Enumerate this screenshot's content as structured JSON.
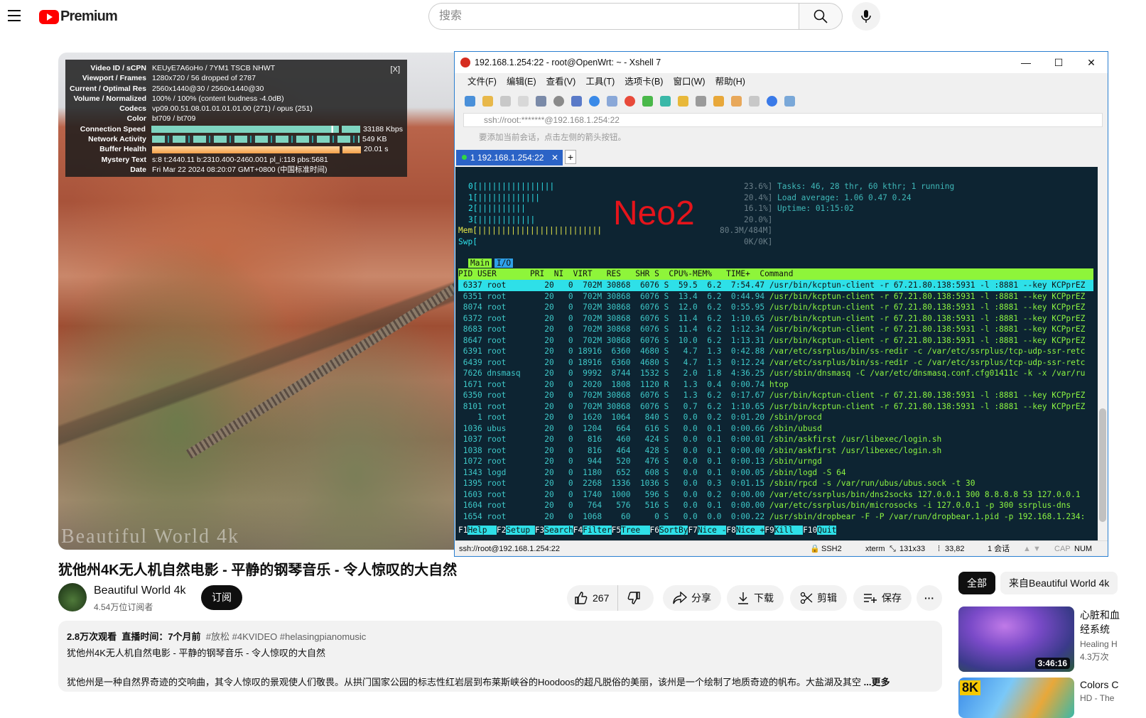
{
  "header": {
    "logo_text": "Premium",
    "search_placeholder": "搜索"
  },
  "stats": {
    "close": "[X]",
    "rows": [
      {
        "k": "Video ID / sCPN",
        "v": "KEUyE7A6oHo  /  7YM1  TSCB  NHWT"
      },
      {
        "k": "Viewport / Frames",
        "v": "1280x720 / 56 dropped of 2787"
      },
      {
        "k": "Current / Optimal Res",
        "v": "2560x1440@30 / 2560x1440@30"
      },
      {
        "k": "Volume / Normalized",
        "v": "100% / 100% (content loudness -4.0dB)"
      },
      {
        "k": "Codecs",
        "v": "vp09.00.51.08.01.01.01.01.00 (271) / opus (251)"
      },
      {
        "k": "Color",
        "v": "bt709 / bt709"
      },
      {
        "k": "Connection Speed",
        "v": "33188 Kbps"
      },
      {
        "k": "Network Activity",
        "v": "549 KB"
      },
      {
        "k": "Buffer Health",
        "v": "20.01 s"
      },
      {
        "k": "Mystery Text",
        "v": "s:8 t:2440.11 b:2310.400-2460.001 pl_i:118 pbs:5681"
      },
      {
        "k": "Date",
        "v": "Fri Mar 22 2024 08:20:07 GMT+0800 (中国标准时间)"
      }
    ]
  },
  "player": {
    "watermark": "Beautiful World 4k"
  },
  "xshell": {
    "title": "192.168.1.254:22 - root@OpenWrt: ~ - Xshell 7",
    "menu": [
      "文件(F)",
      "编辑(E)",
      "查看(V)",
      "工具(T)",
      "选项卡(B)",
      "窗口(W)",
      "帮助(H)"
    ],
    "address": "ssh://root:*******@192.168.1.254:22",
    "hint": "要添加当前会话，点击左侧的箭头按钮。",
    "tab_label": "1 192.168.1.254:22",
    "status": {
      "conn": "ssh://root@192.168.1.254:22",
      "proto": "SSH2",
      "term": "xterm",
      "size": "131x33",
      "cursor": "33,82",
      "sessions": "1 会话",
      "cap": "CAP",
      "num": "NUM"
    }
  },
  "htop": {
    "overlay_text": "Neo2",
    "cpu_lines": [
      "0[||||||||||||||||",
      "1[|||||||||||||",
      "2[||||||||||",
      "3[||||||||||||",
      "Mem[||||||||||||||||||||||||||",
      "Swp["
    ],
    "cpu_values": [
      "23.6%]",
      "20.4%]",
      "16.1%]",
      "20.0%]",
      "80.3M/484M]",
      "0K/0K]"
    ],
    "tasks": "Tasks: 46, 28 thr, 60 kthr; 1 running",
    "load": "Load average: 1.06 0.47 0.24",
    "uptime": "Uptime: 01:15:02",
    "tab_main": "Main",
    "tab_io": "I/O",
    "header": "PID USER       PRI  NI  VIRT   RES   SHR S  CPU%-MEM%   TIME+  Command",
    "rows": [
      {
        "p": " 6337 root        20   0  702M 30868  6076 S  59.5  6.2  7:54.47 ",
        "c": "/usr/bin/kcptun-client -r 67.21.80.138:5931 -l :8881 --key KCPprEZ"
      },
      {
        "p": " 6351 root        20   0  702M 30868  6076 S  13.4  6.2  0:44.94 ",
        "c": "/usr/bin/kcptun-client -r 67.21.80.138:5931 -l :8881 --key KCPprEZ"
      },
      {
        "p": " 8074 root        20   0  702M 30868  6076 S  12.0  6.2  0:55.95 ",
        "c": "/usr/bin/kcptun-client -r 67.21.80.138:5931 -l :8881 --key KCPprEZ"
      },
      {
        "p": " 6372 root        20   0  702M 30868  6076 S  11.4  6.2  1:10.65 ",
        "c": "/usr/bin/kcptun-client -r 67.21.80.138:5931 -l :8881 --key KCPprEZ"
      },
      {
        "p": " 8683 root        20   0  702M 30868  6076 S  11.4  6.2  1:12.34 ",
        "c": "/usr/bin/kcptun-client -r 67.21.80.138:5931 -l :8881 --key KCPprEZ"
      },
      {
        "p": " 8647 root        20   0  702M 30868  6076 S  10.0  6.2  1:13.31 ",
        "c": "/usr/bin/kcptun-client -r 67.21.80.138:5931 -l :8881 --key KCPprEZ"
      },
      {
        "p": " 6391 root        20   0 18916  6360  4680 S   4.7  1.3  0:42.88 ",
        "c": "/var/etc/ssrplus/bin/ss-redir -c /var/etc/ssrplus/tcp-udp-ssr-retc"
      },
      {
        "p": " 6439 root        20   0 18916  6360  4680 S   4.7  1.3  0:12.24 ",
        "c": "/var/etc/ssrplus/bin/ss-redir -c /var/etc/ssrplus/tcp-udp-ssr-retc"
      },
      {
        "p": " 7626 dnsmasq     20   0  9992  8744  1532 S   2.0  1.8  4:36.25 ",
        "c": "/usr/sbin/dnsmasq -C /var/etc/dnsmasq.conf.cfg01411c -k -x /var/ru"
      },
      {
        "p": " 1671 root        20   0  2020  1808  1120 R   1.3  0.4  0:00.74 ",
        "c": "htop"
      },
      {
        "p": " 6350 root        20   0  702M 30868  6076 S   1.3  6.2  0:17.67 ",
        "c": "/usr/bin/kcptun-client -r 67.21.80.138:5931 -l :8881 --key KCPprEZ"
      },
      {
        "p": " 8101 root        20   0  702M 30868  6076 S   0.7  6.2  1:10.65 ",
        "c": "/usr/bin/kcptun-client -r 67.21.80.138:5931 -l :8881 --key KCPprEZ"
      },
      {
        "p": "    1 root        20   0  1620  1064   840 S   0.0  0.2  0:01.20 ",
        "c": "/sbin/procd"
      },
      {
        "p": " 1036 ubus        20   0  1204   664   616 S   0.0  0.1  0:00.66 ",
        "c": "/sbin/ubusd"
      },
      {
        "p": " 1037 root        20   0   816   460   424 S   0.0  0.1  0:00.01 ",
        "c": "/sbin/askfirst /usr/libexec/login.sh"
      },
      {
        "p": " 1038 root        20   0   816   464   428 S   0.0  0.1  0:00.00 ",
        "c": "/sbin/askfirst /usr/libexec/login.sh"
      },
      {
        "p": " 1072 root        20   0   944   520   476 S   0.0  0.1  0:00.13 ",
        "c": "/sbin/urngd"
      },
      {
        "p": " 1343 logd        20   0  1180   652   608 S   0.0  0.1  0:00.05 ",
        "c": "/sbin/logd -S 64"
      },
      {
        "p": " 1395 root        20   0  2268  1336  1036 S   0.0  0.3  0:01.15 ",
        "c": "/sbin/rpcd -s /var/run/ubus/ubus.sock -t 30"
      },
      {
        "p": " 1603 root        20   0  1740  1000   596 S   0.0  0.2  0:00.00 ",
        "c": "/var/etc/ssrplus/bin/dns2socks 127.0.0.1 300 8.8.8.8 53 127.0.0.1"
      },
      {
        "p": " 1604 root        20   0   764   576   516 S   0.0  0.1  0:00.00 ",
        "c": "/var/etc/ssrplus/bin/microsocks -i 127.0.0.1 -p 300 ssrplus-dns"
      },
      {
        "p": " 1654 root        20   0  1068    60     0 S   0.0  0.0  0:00.22 ",
        "c": "/usr/sbin/dropbear -F -P /var/run/dropbear.1.pid -p 192.168.1.234:"
      }
    ],
    "fkeys": [
      {
        "k": "F1",
        "l": "Help  "
      },
      {
        "k": "F2",
        "l": "Setup "
      },
      {
        "k": "F3",
        "l": "Search"
      },
      {
        "k": "F4",
        "l": "Filter"
      },
      {
        "k": "F5",
        "l": "Tree  "
      },
      {
        "k": "F6",
        "l": "SortBy"
      },
      {
        "k": "F7",
        "l": "Nice -"
      },
      {
        "k": "F8",
        "l": "Nice +"
      },
      {
        "k": "F9",
        "l": "Kill  "
      },
      {
        "k": "F10",
        "l": "Quit"
      }
    ]
  },
  "video": {
    "title": "犹他州4K无人机自然电影 - 平静的钢琴音乐 - 令人惊叹的大自然",
    "channel": "Beautiful World 4k",
    "subscribers": "4.54万位订阅者",
    "subscribe": "订阅",
    "likes": "267",
    "share": "分享",
    "download": "下载",
    "clip": "剪辑",
    "save": "保存",
    "more": "···"
  },
  "description": {
    "views": "2.8万次观看",
    "live": "直播时间：7个月前",
    "tags": [
      "#放松",
      "#4KVIDEO",
      "#helasingpianomusic"
    ],
    "line1": "犹他州4K无人机自然电影 - 平静的钢琴音乐 - 令人惊叹的大自然",
    "line2": "犹他州是一种自然界奇迹的交响曲，其令人惊叹的景观使人们敬畏。从拱门国家公园的标志性红岩层到布莱斯峡谷的Hoodoos的超凡脱俗的美丽，该州是一个绘制了地质奇迹的帆布。大盐湖及其空",
    "more": "...更多"
  },
  "sidebar": {
    "chips": [
      "全部",
      "来自Beautiful World 4k"
    ],
    "videos": [
      {
        "title": "心脏和血",
        "title2": "经系统",
        "channel": "Healing H",
        "views": "4.3万次",
        "duration": "3:46:16"
      },
      {
        "title": "Colors C",
        "title2": "HD - The",
        "badge": "8K"
      }
    ]
  }
}
